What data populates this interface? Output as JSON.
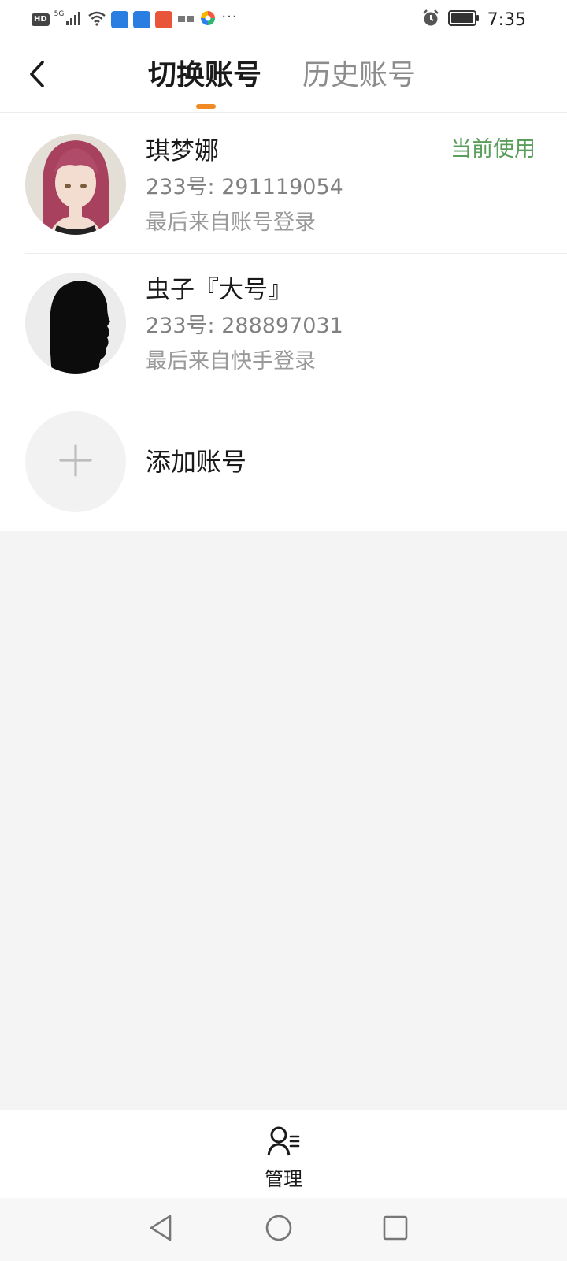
{
  "status_bar": {
    "network_label": "5G",
    "hd_label": "HD",
    "more_dots": "···",
    "time": "7:35"
  },
  "header": {
    "tabs": [
      {
        "label": "切换账号",
        "active": true
      },
      {
        "label": "历史账号",
        "active": false
      }
    ],
    "accent_color": "#f08a24"
  },
  "accounts": [
    {
      "name": "琪梦娜",
      "id_text": "233号: 291119054",
      "login_text": "最后来自账号登录",
      "current_label": "当前使用"
    },
    {
      "name": "虫子『大号』",
      "id_text": "233号: 288897031",
      "login_text": "最后来自快手登录"
    }
  ],
  "add_account": {
    "label": "添加账号"
  },
  "bottom_bar": {
    "manage_label": "管理"
  },
  "colors": {
    "current_green": "#5a9e5c",
    "background_gray": "#f4f4f4"
  }
}
